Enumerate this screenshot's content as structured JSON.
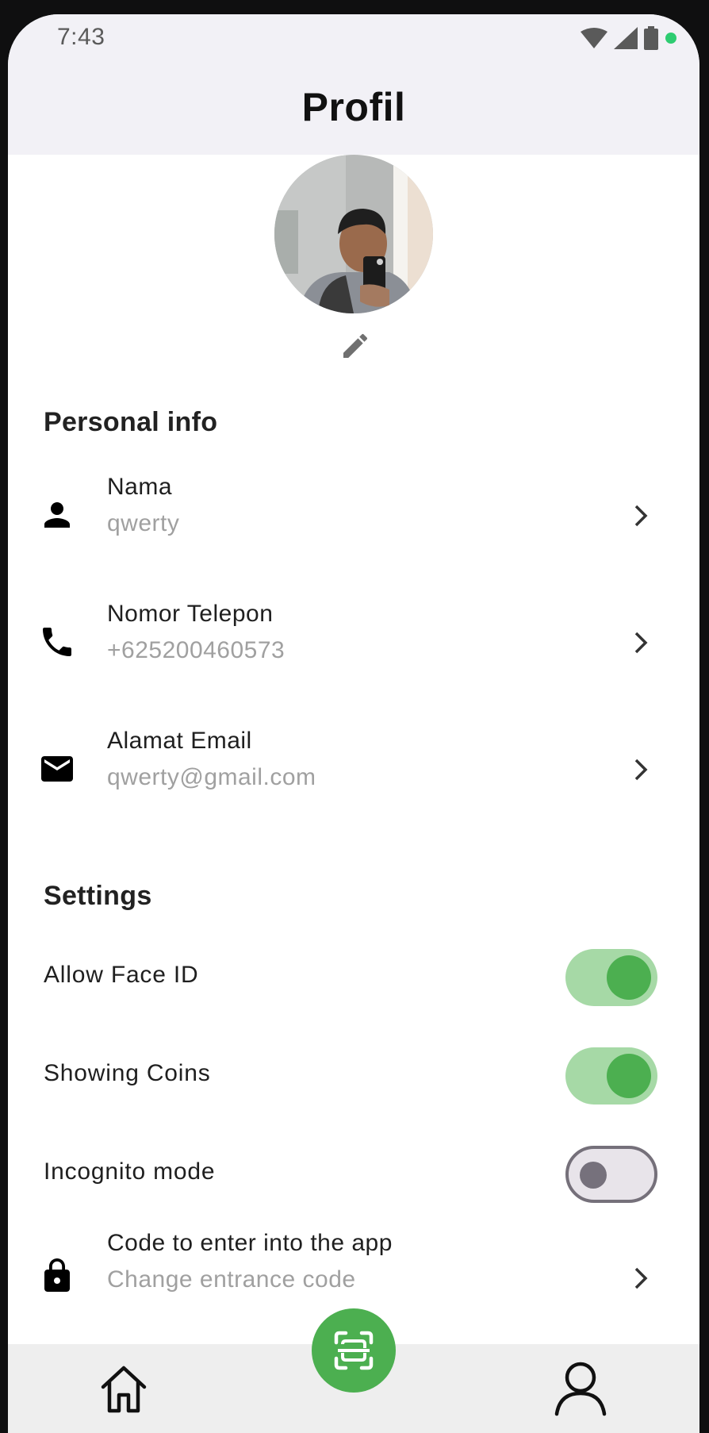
{
  "status_bar": {
    "time": "7:43",
    "icons": [
      "wifi-icon",
      "cellular-icon",
      "battery-icon",
      "green-dot-indicator"
    ]
  },
  "header": {
    "title": "Profil"
  },
  "profile": {
    "avatar_icon": "profile-photo",
    "edit_icon": "pencil-icon"
  },
  "personal_info": {
    "title": "Personal info",
    "items": [
      {
        "icon": "person-icon",
        "label": "Nama",
        "value": "qwerty"
      },
      {
        "icon": "phone-icon",
        "label": "Nomor Telepon",
        "value": "+625200460573"
      },
      {
        "icon": "email-icon",
        "label": "Alamat Email",
        "value": "qwerty@gmail.com"
      }
    ]
  },
  "settings": {
    "title": "Settings",
    "toggles": [
      {
        "label": "Allow Face ID",
        "on": true
      },
      {
        "label": "Showing Coins",
        "on": true
      },
      {
        "label": "Incognito mode",
        "on": false
      }
    ],
    "code_item": {
      "icon": "lock-icon",
      "label": "Code to enter into the app",
      "value": "Change entrance code"
    }
  },
  "bottom_nav": {
    "items": [
      {
        "icon": "home-icon"
      },
      {
        "icon": "person-outline-icon"
      }
    ],
    "fab_icon": "scan-icon"
  },
  "colors": {
    "accent": "#4caf50",
    "toggle_track_on": "#a6d9a6",
    "header_bg": "#f2f1f6"
  }
}
